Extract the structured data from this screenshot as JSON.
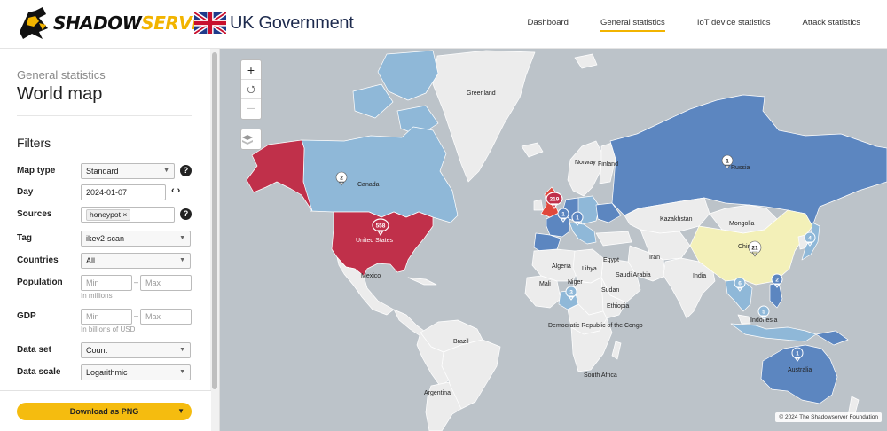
{
  "header": {
    "logo_part1": "SHADOW",
    "logo_part2": "SERVER",
    "partner": "UK Government",
    "nav": [
      {
        "label": "Dashboard",
        "active": false
      },
      {
        "label": "General statistics",
        "active": true
      },
      {
        "label": "IoT device statistics",
        "active": false
      },
      {
        "label": "Attack statistics",
        "active": false
      }
    ]
  },
  "sidebar": {
    "breadcrumb": "General statistics",
    "title": "World map",
    "filters_heading": "Filters",
    "map_type": {
      "label": "Map type",
      "value": "Standard",
      "help": "?"
    },
    "day": {
      "label": "Day",
      "value": "2024-01-07",
      "prev": "‹",
      "next": "›"
    },
    "sources": {
      "label": "Sources",
      "chip": "honeypot",
      "chip_remove": "×",
      "help": "?"
    },
    "tag": {
      "label": "Tag",
      "value": "ikev2-scan"
    },
    "countries": {
      "label": "Countries",
      "value": "All"
    },
    "population": {
      "label": "Population",
      "min_placeholder": "Min",
      "max_placeholder": "Max",
      "separator": "–",
      "hint": "In millions"
    },
    "gdp": {
      "label": "GDP",
      "min_placeholder": "Min",
      "max_placeholder": "Max",
      "separator": "–",
      "hint": "In billions of USD"
    },
    "data_set": {
      "label": "Data set",
      "value": "Count"
    },
    "data_scale": {
      "label": "Data scale",
      "value": "Logarithmic"
    },
    "download": "Download as PNG",
    "download_caret": "▼"
  },
  "map": {
    "zoom_in": "+",
    "zoom_reset": "⭯",
    "zoom_out": "—",
    "layers_icon": "layers-icon",
    "attribution": "© 2024 The Shadowserver Foundation",
    "colors": {
      "ocean": "#bcc3c9",
      "land": "#ececec",
      "low": "#f3f0b8",
      "light_blue": "#8fb8d8",
      "mid_blue": "#5c86c0",
      "high": "#c0304a",
      "orange": "#e0483c",
      "border": "#ffffff"
    },
    "labels": [
      {
        "text": "Greenland"
      },
      {
        "text": "Canada"
      },
      {
        "text": "United States"
      },
      {
        "text": "Mexico"
      },
      {
        "text": "Brazil"
      },
      {
        "text": "Argentina"
      },
      {
        "text": "Norway"
      },
      {
        "text": "Finland"
      },
      {
        "text": "Russia"
      },
      {
        "text": "Kazakhstan"
      },
      {
        "text": "Mongolia"
      },
      {
        "text": "China"
      },
      {
        "text": "Iran"
      },
      {
        "text": "India"
      },
      {
        "text": "Algeria"
      },
      {
        "text": "Libya"
      },
      {
        "text": "Egypt"
      },
      {
        "text": "Saudi Arabia"
      },
      {
        "text": "Mali"
      },
      {
        "text": "Niger"
      },
      {
        "text": "Sudan"
      },
      {
        "text": "Ethiopia"
      },
      {
        "text": "Democratic Republic of the Congo"
      },
      {
        "text": "South Africa"
      },
      {
        "text": "Indonesia"
      },
      {
        "text": "Australia"
      }
    ],
    "markers": [
      {
        "country": "United States",
        "count": "558",
        "style": "high"
      },
      {
        "country": "United Kingdom",
        "count": "219",
        "style": "high"
      },
      {
        "country": "China",
        "count": "21",
        "style": "low"
      },
      {
        "country": "Canada",
        "count": "2",
        "style": "light"
      },
      {
        "country": "Russia",
        "count": "1",
        "style": "mid"
      },
      {
        "country": "France",
        "count": "1",
        "style": "mid"
      },
      {
        "country": "Germany",
        "count": "1",
        "style": "mid"
      },
      {
        "country": "Japan",
        "count": "4",
        "style": "light"
      },
      {
        "country": "Thailand",
        "count": "6",
        "style": "light"
      },
      {
        "country": "Philippines",
        "count": "2",
        "style": "mid"
      },
      {
        "country": "Indonesia",
        "count": "5",
        "style": "light"
      },
      {
        "country": "Nigeria",
        "count": "3",
        "style": "light"
      },
      {
        "country": "Australia",
        "count": "1",
        "style": "mid"
      }
    ]
  }
}
